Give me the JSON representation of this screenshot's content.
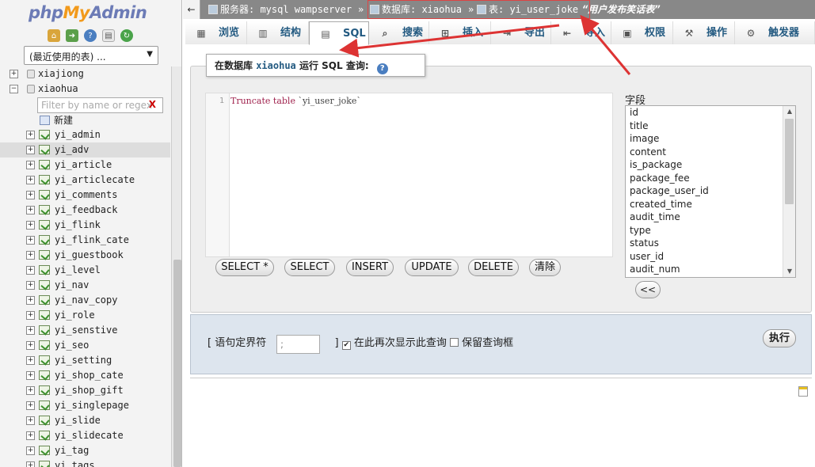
{
  "nav": {
    "logo_php": "php",
    "logo_my": "My",
    "logo_admin": "Admin",
    "recent_select": "(最近使用的表) ...",
    "databases": [
      {
        "name": "xiajiong",
        "expander": "+"
      },
      {
        "name": "xiaohua",
        "expander": "−"
      }
    ],
    "filter_placeholder": "Filter by name or regex",
    "filter_clear": "X",
    "new_label": "新建",
    "tables": [
      "yi_admin",
      "yi_adv",
      "yi_article",
      "yi_articlecate",
      "yi_comments",
      "yi_feedback",
      "yi_flink",
      "yi_flink_cate",
      "yi_guestbook",
      "yi_level",
      "yi_nav",
      "yi_nav_copy",
      "yi_role",
      "yi_senstive",
      "yi_seo",
      "yi_setting",
      "yi_shop_cate",
      "yi_shop_gift",
      "yi_singlepage",
      "yi_slide",
      "yi_slidecate",
      "yi_tag",
      "yi_tags"
    ],
    "selected_table": "yi_adv"
  },
  "breadcrumb": {
    "server": "服务器: mysql wampserver",
    "separator": "»",
    "database": "数据库: xiaohua",
    "table": "表: yi_user_joke",
    "comment": "“用户发布笑话表”"
  },
  "tabs": [
    {
      "label": "浏览",
      "icon": "browse-icon"
    },
    {
      "label": "结构",
      "icon": "structure-icon"
    },
    {
      "label": "SQL",
      "icon": "sql-icon"
    },
    {
      "label": "搜索",
      "icon": "search-icon"
    },
    {
      "label": "插入",
      "icon": "insert-icon"
    },
    {
      "label": "导出",
      "icon": "export-icon"
    },
    {
      "label": "导入",
      "icon": "import-icon"
    },
    {
      "label": "权限",
      "icon": "privileges-icon"
    },
    {
      "label": "操作",
      "icon": "operations-icon"
    },
    {
      "label": "触发器",
      "icon": "triggers-icon"
    }
  ],
  "active_tab": "SQL",
  "query": {
    "heading_prefix": "在数据库",
    "heading_db": "xiaohua",
    "heading_suffix": "运行 SQL 查询:",
    "line_number": "1",
    "code_keyword": "Truncate table",
    "code_ident": "`yi_user_joke`",
    "buttons": [
      "SELECT *",
      "SELECT",
      "INSERT",
      "UPDATE",
      "DELETE",
      "清除"
    ],
    "fields_label": "字段",
    "fields": [
      "id",
      "title",
      "image",
      "content",
      "is_package",
      "package_fee",
      "package_user_id",
      "created_time",
      "audit_time",
      "type",
      "status",
      "user_id",
      "audit_num"
    ],
    "insert_field_button": "<<"
  },
  "options": {
    "delimiter_label_open": "[ 语句定界符",
    "delimiter_value": ";",
    "delimiter_label_close": "]",
    "show_again_label": "在此再次显示此查询",
    "show_again_checked": "✔",
    "retain_label": "保留查询框",
    "go_button": "执行"
  },
  "colors": {
    "annotation_red": "#dd3333",
    "link_blue": "#235a81",
    "options_bg": "#dde5ee"
  }
}
